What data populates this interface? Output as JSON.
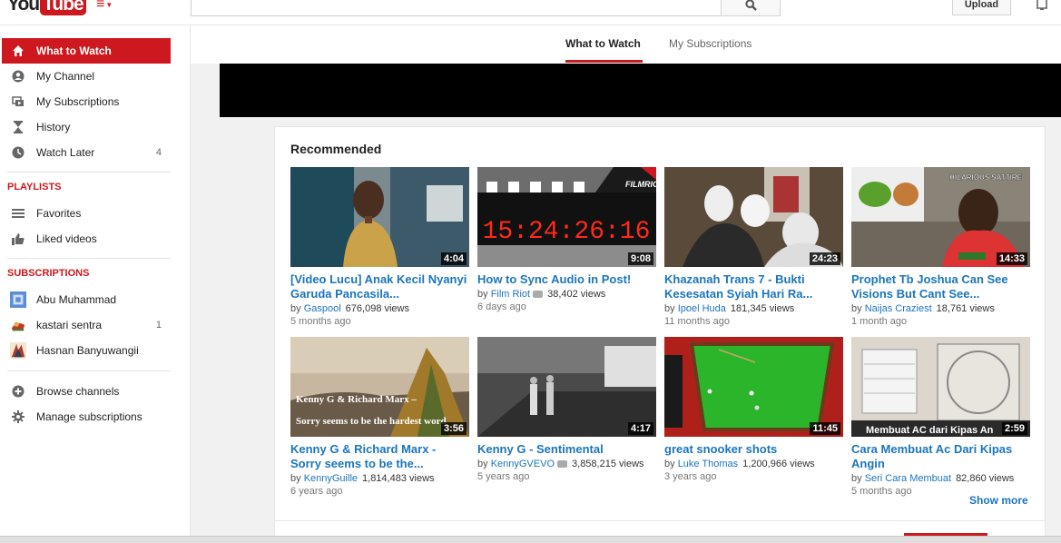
{
  "header": {
    "logo_you": "You",
    "logo_tube": "Tube",
    "search_placeholder": "",
    "upload_label": "Upload"
  },
  "sidebar": {
    "main_items": [
      {
        "label": "What to Watch",
        "icon": "home-icon",
        "active": true
      },
      {
        "label": "My Channel",
        "icon": "person-icon"
      },
      {
        "label": "My Subscriptions",
        "icon": "subscriptions-icon"
      },
      {
        "label": "History",
        "icon": "hourglass-icon"
      },
      {
        "label": "Watch Later",
        "icon": "clock-icon",
        "count": "4"
      }
    ],
    "playlists_heading": "PLAYLISTS",
    "playlists": [
      {
        "label": "Favorites",
        "icon": "list-icon"
      },
      {
        "label": "Liked videos",
        "icon": "thumbs-up-icon"
      }
    ],
    "subscriptions_heading": "SUBSCRIPTIONS",
    "subscriptions": [
      {
        "label": "Abu Muhammad",
        "count": ""
      },
      {
        "label": "kastari sentra",
        "count": "1"
      },
      {
        "label": "Hasnan Banyuwangii",
        "count": ""
      }
    ],
    "bottom_items": [
      {
        "label": "Browse channels",
        "icon": "plus-circle-icon"
      },
      {
        "label": "Manage subscriptions",
        "icon": "gear-icon"
      }
    ]
  },
  "tabs": [
    {
      "label": "What to Watch",
      "active": true
    },
    {
      "label": "My Subscriptions",
      "active": false
    }
  ],
  "section_title": "Recommended",
  "videos": [
    {
      "title": "[Video Lucu] Anak Kecil Nyanyi Garuda Pancasila...",
      "channel": "Gaspool",
      "views": "676,098 views",
      "age": "5 months ago",
      "duration": "4:04"
    },
    {
      "title": "How to Sync Audio in Post!",
      "channel": "Film Riot",
      "views": "38,402 views",
      "age": "6 days ago",
      "duration": "9:08",
      "verified": true,
      "thumb_text": "15:24:26:16",
      "thumb_logo": "FILMRIOT"
    },
    {
      "title": "Khazanah Trans 7 - Bukti Kesesatan Syiah Hari Ra...",
      "channel": "Ipoel Huda",
      "views": "181,345 views",
      "age": "11 months ago",
      "duration": "24:23"
    },
    {
      "title": "Prophet Tb Joshua Can See Visions But Cant See...",
      "channel": "Naijas Craziest",
      "views": "18,761 views",
      "age": "1 month ago",
      "duration": "14:33",
      "thumb_text": "HILARIOUS SATTIRE"
    },
    {
      "title": "Kenny G & Richard Marx - Sorry seems to be the...",
      "channel": "KennyGuille",
      "views": "1,814,483 views",
      "age": "6 years ago",
      "duration": "3:56",
      "thumb_text": [
        "Kenny G & Richard Marx –",
        "Sorry seems to be the hardest word"
      ]
    },
    {
      "title": "Kenny G - Sentimental",
      "channel": "KennyGVEVO",
      "views": "3,858,215 views",
      "age": "5 years ago",
      "duration": "4:17",
      "verified": true
    },
    {
      "title": "great snooker shots",
      "channel": "Luke Thomas",
      "views": "1,200,966 views",
      "age": "3 years ago",
      "duration": "11:45"
    },
    {
      "title": "Cara Membuat Ac Dari Kipas Angin",
      "channel": "Seri Cara Membuat",
      "views": "82,860 views",
      "age": "5 months ago",
      "duration": "2:59",
      "thumb_text": "Membuat AC dari Kipas An"
    }
  ],
  "by_label": "by",
  "show_more": "Show more",
  "colors": {
    "accent": "#cc181e",
    "link": "#1b75bc"
  }
}
